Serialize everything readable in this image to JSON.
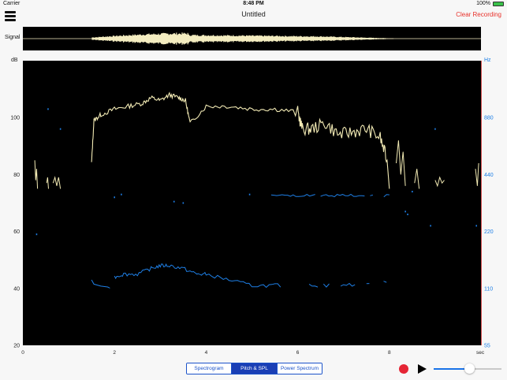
{
  "status_bar": {
    "carrier": "Carrier",
    "time": "8:48 PM",
    "battery": "100%"
  },
  "nav": {
    "title": "Untitled",
    "clear_label": "Clear Recording"
  },
  "signal": {
    "label": "Signal"
  },
  "plot": {
    "left_unit": "dB",
    "right_unit": "Hz",
    "x_unit": "sec",
    "left_ticks": [
      "100",
      "80",
      "60",
      "40",
      "20"
    ],
    "right_ticks": [
      "880",
      "440",
      "220",
      "110",
      "55"
    ],
    "x_ticks": [
      "0",
      "2",
      "4",
      "6",
      "8"
    ],
    "colors": {
      "spl": "#f2eab4",
      "pitch": "#1e7fe6",
      "marker": "#cc2a2a"
    }
  },
  "chart_data": {
    "type": "line",
    "xlabel": "sec",
    "ylabel": "dB",
    "xlim": [
      0,
      10
    ],
    "ylim": [
      20,
      110
    ],
    "y2label": "Hz",
    "y2_ticks": [
      880,
      440,
      220,
      110,
      55
    ],
    "series": [
      {
        "x": [
          0.25,
          0.3,
          0.5,
          0.55,
          0.7,
          0.8,
          1.5,
          1.55,
          1.7,
          2.0,
          2.3,
          2.6,
          2.8,
          3.0,
          3.2,
          3.4,
          3.55,
          3.65,
          4.0,
          4.5,
          5.0,
          5.5,
          6.0,
          6.1,
          6.3,
          6.6,
          6.9,
          7.2,
          7.5,
          7.8,
          7.95,
          8.0,
          8.1,
          8.2,
          8.3,
          8.5,
          8.8,
          9.2,
          9.9
        ],
        "y": [
          85,
          75,
          78,
          75,
          79,
          77,
          84,
          99,
          101,
          103,
          104,
          105,
          107,
          106,
          108,
          107,
          106,
          98,
          104,
          104,
          103,
          103,
          102,
          96,
          96,
          98,
          94,
          95,
          96,
          93,
          85,
          75,
          84,
          90,
          84,
          78,
          77,
          78,
          82
        ]
      },
      {
        "x": [
          1.5,
          1.6,
          1.9,
          2.0,
          2.2,
          2.5,
          2.8,
          3.0,
          3.2,
          3.5,
          3.8,
          4.0,
          4.5,
          5.0,
          5.5,
          6.0,
          6.5,
          7.0,
          7.5,
          8.0,
          5.4,
          6.0,
          6.5,
          7.0,
          7.5,
          8.0
        ],
        "y": [
          43,
          41,
          40,
          44,
          45,
          45,
          47,
          48,
          48,
          47,
          45,
          45,
          43,
          41,
          41,
          41,
          41,
          41,
          42,
          42,
          73,
          73,
          73,
          73,
          73,
          73
        ]
      }
    ]
  }
}
